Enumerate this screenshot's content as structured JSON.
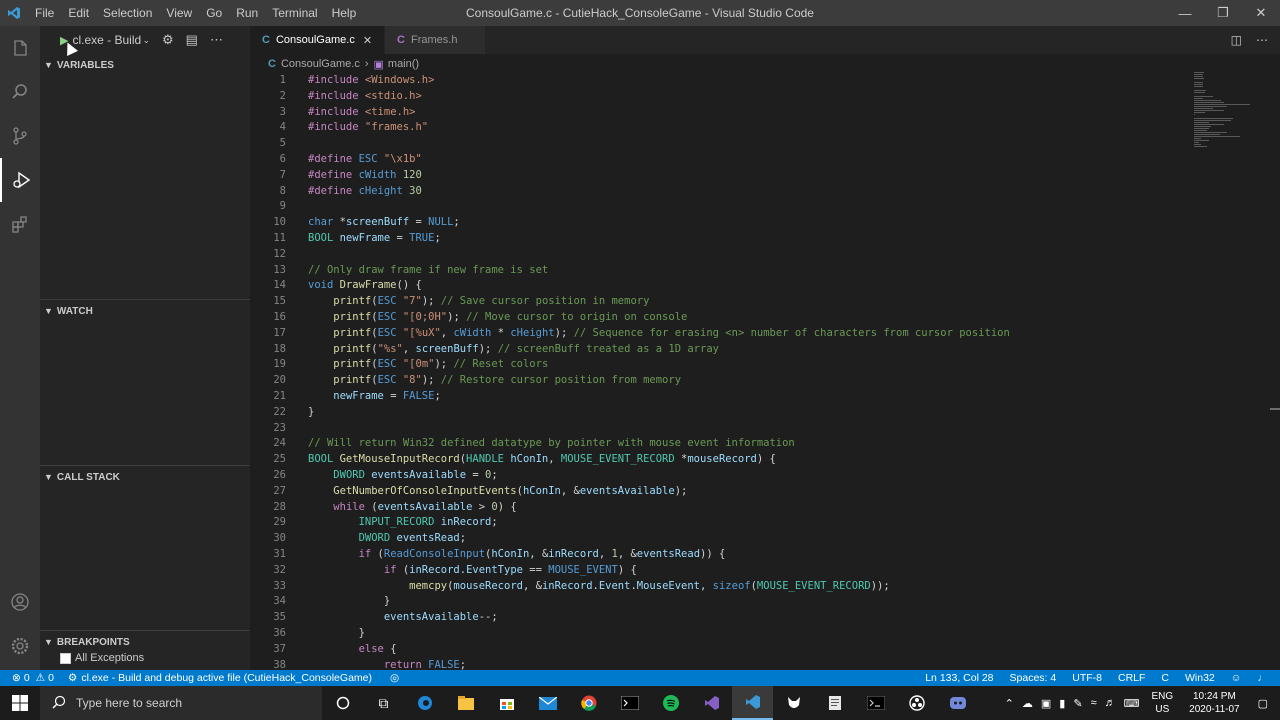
{
  "titlebar": {
    "menu": [
      "File",
      "Edit",
      "Selection",
      "View",
      "Go",
      "Run",
      "Terminal",
      "Help"
    ],
    "title": "ConsoulGame.c - CutieHack_ConsoleGame - Visual Studio Code"
  },
  "debug": {
    "config": "cl.exe - Build a",
    "sections": {
      "variables": "VARIABLES",
      "watch": "WATCH",
      "callstack": "CALL STACK",
      "breakpoints": "BREAKPOINTS"
    },
    "all_exceptions": "All Exceptions"
  },
  "tabs": [
    {
      "label": "ConsoulGame.c",
      "active": true
    },
    {
      "label": "Frames.h",
      "active": false
    }
  ],
  "breadcrumb": {
    "file": "ConsoulGame.c",
    "symbol": "main()"
  },
  "code_lines": [
    [
      [
        "pp",
        "#include "
      ],
      [
        "str",
        "<Windows.h>"
      ]
    ],
    [
      [
        "pp",
        "#include "
      ],
      [
        "str",
        "<stdio.h>"
      ]
    ],
    [
      [
        "pp",
        "#include "
      ],
      [
        "str",
        "<time.h>"
      ]
    ],
    [
      [
        "pp",
        "#include "
      ],
      [
        "str",
        "\"frames.h\""
      ]
    ],
    [],
    [
      [
        "pp",
        "#define "
      ],
      [
        "mac",
        "ESC "
      ],
      [
        "str",
        "\"\\x1b\""
      ]
    ],
    [
      [
        "pp",
        "#define "
      ],
      [
        "mac",
        "cWidth "
      ],
      [
        "num",
        "120"
      ]
    ],
    [
      [
        "pp",
        "#define "
      ],
      [
        "mac",
        "cHeight "
      ],
      [
        "num",
        "30"
      ]
    ],
    [],
    [
      [
        "kw",
        "char "
      ],
      [
        "tx",
        "*"
      ],
      [
        "var",
        "screenBuff"
      ],
      [
        "tx",
        " = "
      ],
      [
        "mac",
        "NULL"
      ],
      [
        "tx",
        ";"
      ]
    ],
    [
      [
        "ty",
        "BOOL "
      ],
      [
        "var",
        "newFrame"
      ],
      [
        "tx",
        " = "
      ],
      [
        "mac",
        "TRUE"
      ],
      [
        "tx",
        ";"
      ]
    ],
    [],
    [
      [
        "cm",
        "// Only draw frame if new frame is set"
      ]
    ],
    [
      [
        "kw",
        "void "
      ],
      [
        "fn",
        "DrawFrame"
      ],
      [
        "tx",
        "() {"
      ]
    ],
    [
      [
        "tx",
        "    "
      ],
      [
        "fn",
        "printf"
      ],
      [
        "tx",
        "("
      ],
      [
        "mac",
        "ESC "
      ],
      [
        "str",
        "\"7\""
      ],
      [
        "tx",
        "); "
      ],
      [
        "cm",
        "// Save cursor position in memory"
      ]
    ],
    [
      [
        "tx",
        "    "
      ],
      [
        "fn",
        "printf"
      ],
      [
        "tx",
        "("
      ],
      [
        "mac",
        "ESC "
      ],
      [
        "str",
        "\"[0;0H\""
      ],
      [
        "tx",
        "); "
      ],
      [
        "cm",
        "// Move cursor to origin on console"
      ]
    ],
    [
      [
        "tx",
        "    "
      ],
      [
        "fn",
        "printf"
      ],
      [
        "tx",
        "("
      ],
      [
        "mac",
        "ESC "
      ],
      [
        "str",
        "\"[%uX\""
      ],
      [
        "tx",
        ", "
      ],
      [
        "mac",
        "cWidth"
      ],
      [
        "tx",
        " * "
      ],
      [
        "mac",
        "cHeight"
      ],
      [
        "tx",
        "); "
      ],
      [
        "cm",
        "// Sequence for erasing <n> number of characters from cursor position"
      ]
    ],
    [
      [
        "tx",
        "    "
      ],
      [
        "fn",
        "printf"
      ],
      [
        "tx",
        "("
      ],
      [
        "str",
        "\"%s\""
      ],
      [
        "tx",
        ", "
      ],
      [
        "var",
        "screenBuff"
      ],
      [
        "tx",
        "); "
      ],
      [
        "cm",
        "// screenBuff treated as a 1D array"
      ]
    ],
    [
      [
        "tx",
        "    "
      ],
      [
        "fn",
        "printf"
      ],
      [
        "tx",
        "("
      ],
      [
        "mac",
        "ESC "
      ],
      [
        "str",
        "\"[0m\""
      ],
      [
        "tx",
        "); "
      ],
      [
        "cm",
        "// Reset colors"
      ]
    ],
    [
      [
        "tx",
        "    "
      ],
      [
        "fn",
        "printf"
      ],
      [
        "tx",
        "("
      ],
      [
        "mac",
        "ESC "
      ],
      [
        "str",
        "\"8\""
      ],
      [
        "tx",
        "); "
      ],
      [
        "cm",
        "// Restore cursor position from memory"
      ]
    ],
    [
      [
        "tx",
        "    "
      ],
      [
        "var",
        "newFrame"
      ],
      [
        "tx",
        " = "
      ],
      [
        "mac",
        "FALSE"
      ],
      [
        "tx",
        ";"
      ]
    ],
    [
      [
        "tx",
        "}"
      ]
    ],
    [],
    [
      [
        "cm",
        "// Will return Win32 defined datatype by pointer with mouse event information"
      ]
    ],
    [
      [
        "ty",
        "BOOL "
      ],
      [
        "fn",
        "GetMouseInputRecord"
      ],
      [
        "tx",
        "("
      ],
      [
        "ty",
        "HANDLE "
      ],
      [
        "var",
        "hConIn"
      ],
      [
        "tx",
        ", "
      ],
      [
        "ty",
        "MOUSE_EVENT_RECORD "
      ],
      [
        "tx",
        "*"
      ],
      [
        "var",
        "mouseRecord"
      ],
      [
        "tx",
        ") {"
      ]
    ],
    [
      [
        "tx",
        "    "
      ],
      [
        "ty",
        "DWORD "
      ],
      [
        "var",
        "eventsAvailable"
      ],
      [
        "tx",
        " = "
      ],
      [
        "num",
        "0"
      ],
      [
        "tx",
        ";"
      ]
    ],
    [
      [
        "tx",
        "    "
      ],
      [
        "fn",
        "GetNumberOfConsoleInputEvents"
      ],
      [
        "tx",
        "("
      ],
      [
        "var",
        "hConIn"
      ],
      [
        "tx",
        ", &"
      ],
      [
        "var",
        "eventsAvailable"
      ],
      [
        "tx",
        ");"
      ]
    ],
    [
      [
        "tx",
        "    "
      ],
      [
        "pp",
        "while "
      ],
      [
        "tx",
        "("
      ],
      [
        "var",
        "eventsAvailable"
      ],
      [
        "tx",
        " > "
      ],
      [
        "num",
        "0"
      ],
      [
        "tx",
        ") {"
      ]
    ],
    [
      [
        "tx",
        "        "
      ],
      [
        "ty",
        "INPUT_RECORD "
      ],
      [
        "var",
        "inRecord"
      ],
      [
        "tx",
        ";"
      ]
    ],
    [
      [
        "tx",
        "        "
      ],
      [
        "ty",
        "DWORD "
      ],
      [
        "var",
        "eventsRead"
      ],
      [
        "tx",
        ";"
      ]
    ],
    [
      [
        "tx",
        "        "
      ],
      [
        "pp",
        "if "
      ],
      [
        "tx",
        "("
      ],
      [
        "mac",
        "ReadConsoleInput"
      ],
      [
        "tx",
        "("
      ],
      [
        "var",
        "hConIn"
      ],
      [
        "tx",
        ", &"
      ],
      [
        "var",
        "inRecord"
      ],
      [
        "tx",
        ", "
      ],
      [
        "num",
        "1"
      ],
      [
        "tx",
        ", &"
      ],
      [
        "var",
        "eventsRead"
      ],
      [
        "tx",
        ")) {"
      ]
    ],
    [
      [
        "tx",
        "            "
      ],
      [
        "pp",
        "if "
      ],
      [
        "tx",
        "("
      ],
      [
        "var",
        "inRecord"
      ],
      [
        "tx",
        "."
      ],
      [
        "var",
        "EventType"
      ],
      [
        "tx",
        " == "
      ],
      [
        "mac",
        "MOUSE_EVENT"
      ],
      [
        "tx",
        ") {"
      ]
    ],
    [
      [
        "tx",
        "                "
      ],
      [
        "fn",
        "memcpy"
      ],
      [
        "tx",
        "("
      ],
      [
        "var",
        "mouseRecord"
      ],
      [
        "tx",
        ", &"
      ],
      [
        "var",
        "inRecord"
      ],
      [
        "tx",
        "."
      ],
      [
        "var",
        "Event"
      ],
      [
        "tx",
        "."
      ],
      [
        "var",
        "MouseEvent"
      ],
      [
        "tx",
        ", "
      ],
      [
        "kw",
        "sizeof"
      ],
      [
        "tx",
        "("
      ],
      [
        "ty",
        "MOUSE_EVENT_RECORD"
      ],
      [
        "tx",
        "));"
      ]
    ],
    [
      [
        "tx",
        "            }"
      ]
    ],
    [
      [
        "tx",
        "            "
      ],
      [
        "var",
        "eventsAvailable"
      ],
      [
        "tx",
        "--;"
      ]
    ],
    [
      [
        "tx",
        "        }"
      ]
    ],
    [
      [
        "tx",
        "        "
      ],
      [
        "pp",
        "else "
      ],
      [
        "tx",
        "{"
      ]
    ],
    [
      [
        "tx",
        "            "
      ],
      [
        "pp",
        "return "
      ],
      [
        "mac",
        "FALSE"
      ],
      [
        "tx",
        ";"
      ]
    ]
  ],
  "statusbar": {
    "errors": "0",
    "warnings": "0",
    "debug_config": "cl.exe - Build and debug active file (CutieHack_ConsoleGame)",
    "position": "Ln 133, Col 28",
    "spaces": "Spaces: 4",
    "encoding": "UTF-8",
    "eol": "CRLF",
    "language": "C",
    "platform": "Win32"
  },
  "taskbar": {
    "search_placeholder": "Type here to search",
    "lang_top": "ENG",
    "lang_bottom": "US",
    "time": "10:24 PM",
    "date": "2020-11-07"
  },
  "colors": {
    "statusbar": "#007acc",
    "activity": "#333333",
    "sidebar": "#252526",
    "editor": "#1e1e1e"
  }
}
